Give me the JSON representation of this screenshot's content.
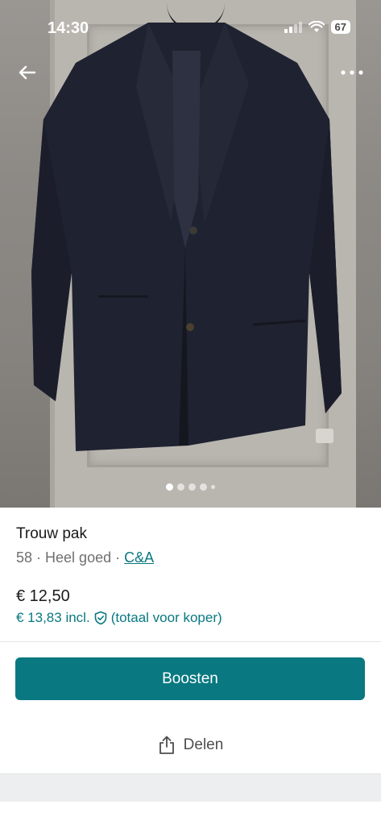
{
  "status_bar": {
    "time": "14:30",
    "battery": "67",
    "signal_icon": "signal-icon",
    "wifi_icon": "wifi-icon"
  },
  "photo": {
    "subject": "dark suit jacket on hanger",
    "carousel": {
      "count": 5,
      "active_index": 0
    }
  },
  "nav": {
    "back_icon": "back-arrow-icon",
    "more_icon": "more-options-icon"
  },
  "item": {
    "title": "Trouw pak",
    "size": "58",
    "separator": " · ",
    "condition": "Heel goed",
    "brand": "C&A",
    "price": "€ 12,50",
    "price_incl": "€ 13,83 incl.",
    "buyer_protection_icon": "shield-check-icon",
    "price_note": "(totaal voor koper)"
  },
  "actions": {
    "boost_label": "Boosten",
    "share_label": "Delen",
    "share_icon": "share-icon"
  },
  "colors": {
    "accent": "#097880",
    "text_primary": "#1a1a1a",
    "text_secondary": "#6f6f6f",
    "divider": "#e3e3e3",
    "footer_band": "#eceeef"
  }
}
